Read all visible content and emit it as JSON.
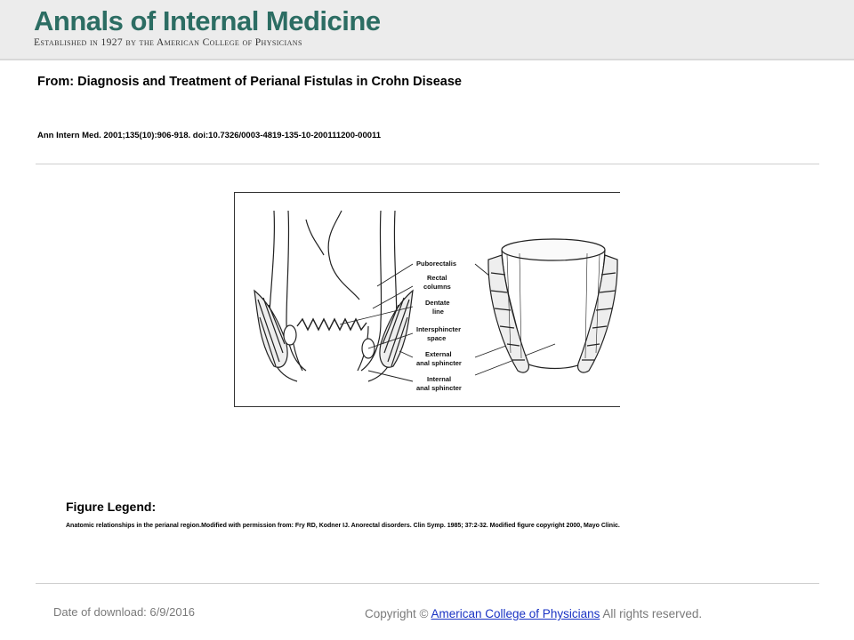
{
  "header": {
    "journal_name": "Annals of Internal Medicine",
    "tagline": "Established in 1927 by the American College of Physicians"
  },
  "article": {
    "from_line": "From: Diagnosis and Treatment of Perianal Fistulas in Crohn Disease",
    "citation": "Ann Intern Med. 2001;135(10):906-918. doi:10.7326/0003-4819-135-10-200111200-00011"
  },
  "figure": {
    "labels": {
      "puborectalis": "Puborectalis",
      "rectal_1": "Rectal",
      "rectal_2": "columns",
      "dentate_1": "Dentate",
      "dentate_2": "line",
      "intersph_1": "Intersphincter",
      "intersph_2": "space",
      "external_1": "External",
      "external_2": "anal sphincter",
      "internal_1": "Internal",
      "internal_2": "anal sphincter"
    }
  },
  "legend": {
    "title": "Figure Legend:",
    "text": "Anatomic relationships in the perianal region.Modified with permission from: Fry RD, Kodner IJ. Anorectal disorders. Clin Symp. 1985; 37:2-32. Modified figure copyright 2000, Mayo Clinic."
  },
  "footer": {
    "date_label": "Date of download:",
    "date_value": "6/9/2016",
    "copyright_prefix": "Copyright ©",
    "publisher_link": "American College of Physicians",
    "rights": "All rights reserved."
  }
}
